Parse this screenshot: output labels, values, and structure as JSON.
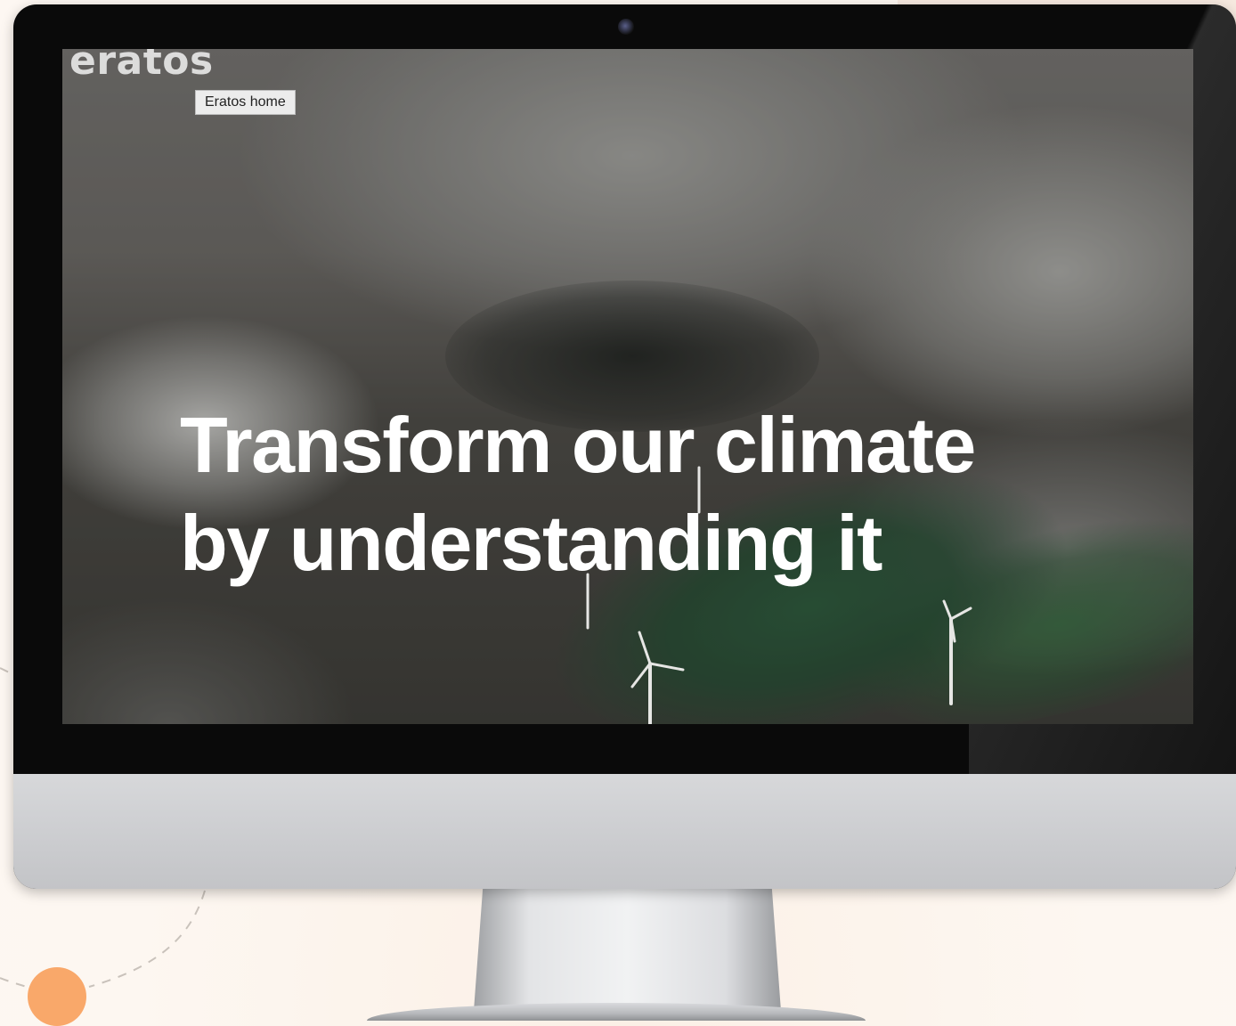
{
  "site": {
    "logo_text": "eratos",
    "home_tooltip": "Eratos home"
  },
  "hero": {
    "title_line_1": "Transform our climate",
    "title_line_2": "by understanding it"
  },
  "colors": {
    "accent_orange": "#f9a86a",
    "page_background": "#fdf6ef",
    "title_text": "#ffffff"
  },
  "icons": {
    "camera": "camera-icon",
    "decoration": "orange-dot-icon"
  }
}
